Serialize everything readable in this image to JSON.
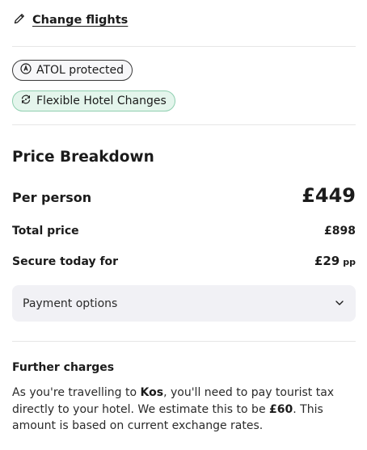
{
  "change_flights": {
    "label": "Change flights",
    "icon": "pencil-icon"
  },
  "badges": {
    "atol": {
      "label": "ATOL protected",
      "icon": "atol-shield-icon"
    },
    "hotel": {
      "label": "Flexible Hotel Changes",
      "icon": "refresh-icon"
    }
  },
  "price_breakdown": {
    "title": "Price Breakdown",
    "per_person_label": "Per person",
    "per_person_value": "£449",
    "total_label": "Total price",
    "total_value": "£898",
    "secure_label": "Secure today for",
    "secure_value": "£29",
    "secure_unit": "pp"
  },
  "payment_options": {
    "label": "Payment options",
    "icon": "chevron-down-icon"
  },
  "further_charges": {
    "title": "Further charges",
    "text_1": "As you're travelling to ",
    "destination": "Kos",
    "text_2": ", you'll need to pay tourist tax directly to your hotel. We estimate this to be ",
    "amount": "£60",
    "text_3": ". This amount is based on current exchange rates."
  },
  "colors": {
    "text": "#1b1b1b",
    "hotel_badge_bg": "#e4f5ec",
    "hotel_badge_border": "#8fcfb0",
    "payment_bg": "#f1f1f5"
  }
}
